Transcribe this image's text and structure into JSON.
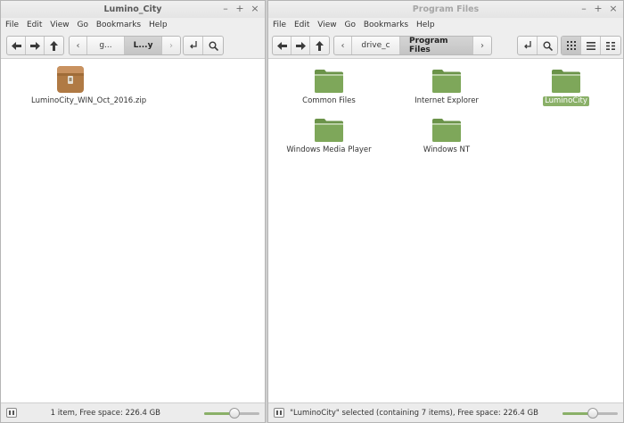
{
  "left_window": {
    "title": "Lumino_City",
    "menu": [
      "File",
      "Edit",
      "View",
      "Go",
      "Bookmarks",
      "Help"
    ],
    "breadcrumbs": [
      "g...",
      "L...y"
    ],
    "files": [
      {
        "name": "LuminoCity_WIN_Oct_2016.zip",
        "icon": "archive-icon"
      }
    ],
    "status": "1 item, Free space: 226.4 GB",
    "zoom_level": 0.55
  },
  "right_window": {
    "title": "Program Files",
    "menu": [
      "File",
      "Edit",
      "View",
      "Go",
      "Bookmarks",
      "Help"
    ],
    "breadcrumbs": [
      "drive_c",
      "Program Files"
    ],
    "folders": [
      {
        "name": "Common Files",
        "selected": false
      },
      {
        "name": "Internet Explorer",
        "selected": false
      },
      {
        "name": "LuminoCity",
        "selected": true
      },
      {
        "name": "Windows Media Player",
        "selected": false
      },
      {
        "name": "Windows NT",
        "selected": false
      }
    ],
    "status": "\"LuminoCity\" selected (containing 7 items), Free space: 226.4 GB",
    "zoom_level": 0.55
  },
  "colors": {
    "accent": "#8ab068",
    "folder": "#7ea75a",
    "folder_dark": "#6b9349"
  },
  "window_controls": [
    "–",
    "+",
    "×"
  ]
}
